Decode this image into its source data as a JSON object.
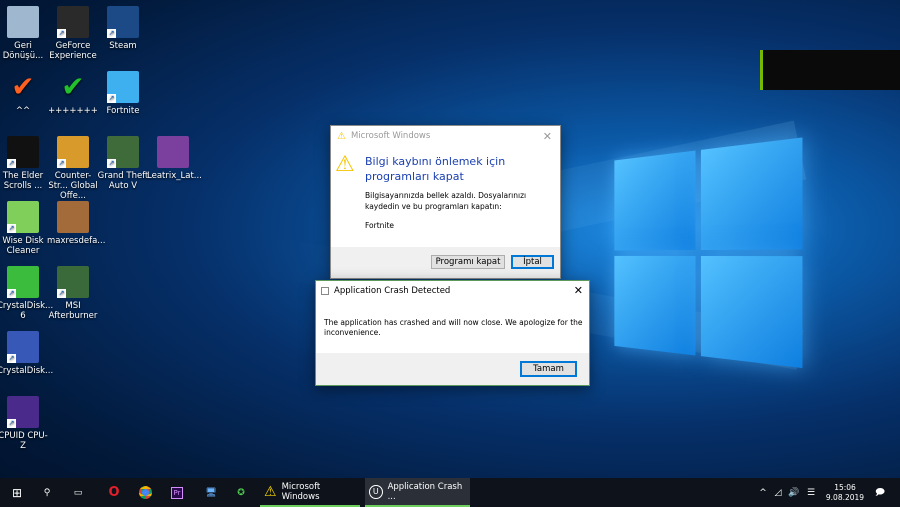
{
  "desktop_icons": [
    {
      "label": "Geri Dönüşü...",
      "icon": "recycle-bin-icon",
      "color": "#9fb8cf"
    },
    {
      "label": "GeForce Experience",
      "icon": "geforce-icon",
      "color": "#2a2a2a"
    },
    {
      "label": "Steam",
      "icon": "steam-icon",
      "color": "#1b4a86"
    },
    {
      "label": "^^",
      "icon": "orange-check-icon",
      "color": "#ff6020"
    },
    {
      "label": "+++++++",
      "icon": "green-check-icon",
      "color": "#22c02a"
    },
    {
      "label": "Fortnite",
      "icon": "fortnite-icon",
      "color": "#3fb0ef"
    },
    {
      "label": "The Elder Scrolls ...",
      "icon": "elder-scrolls-icon",
      "color": "#111111"
    },
    {
      "label": "Counter-Str... Global Offe...",
      "icon": "csgo-icon",
      "color": "#d79a2b"
    },
    {
      "label": "Grand Theft Auto V",
      "icon": "gta-icon",
      "color": "#3f6b3a"
    },
    {
      "label": "Leatrix_Lat...",
      "icon": "winrar-icon",
      "color": "#7b3f9e"
    },
    {
      "label": "Wise Disk Cleaner",
      "icon": "wise-disk-cleaner-icon",
      "color": "#7fcf5a"
    },
    {
      "label": "maxresdefa...",
      "icon": "image-file-icon",
      "color": "#a36a3a"
    },
    {
      "label": "CrystalDisk... 6",
      "icon": "crystaldisk-icon",
      "color": "#3cbc3c"
    },
    {
      "label": "MSI Afterburner",
      "icon": "msi-afterburner-icon",
      "color": "#3a6a3a"
    },
    {
      "label": "CrystalDisk...",
      "icon": "crystaldisk-info-icon",
      "color": "#3858b8"
    },
    {
      "label": "CPUID CPU-Z",
      "icon": "cpuz-icon",
      "color": "#4a2a8a"
    }
  ],
  "dialog1": {
    "title": "Microsoft Windows",
    "heading": "Bilgi kaybını önlemek için programları kapat",
    "message": "Bilgisayarınızda bellek azaldı. Dosyalarınızı kaydedin ve bu programları kapatın:",
    "program": "Fortnite",
    "close_button": "Programı kapat",
    "cancel_button": "İptal"
  },
  "dialog2": {
    "title": "Application Crash Detected",
    "message": "The application has crashed and will now close. We apologize for the inconvenience.",
    "ok_button": "Tamam"
  },
  "taskbar": {
    "tasks": [
      "Microsoft Windows",
      "Application Crash ..."
    ],
    "time": "15:06",
    "date": "9.08.2019",
    "chevron": "^"
  }
}
